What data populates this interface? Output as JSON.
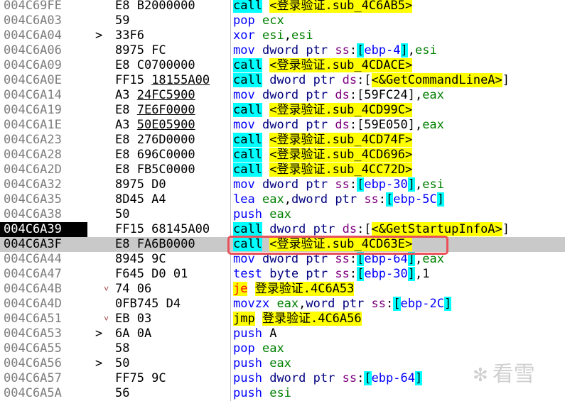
{
  "rows": [
    {
      "addr": "004C69FE",
      "mark": "",
      "bytes": [
        [
          "E8 B2000000",
          false
        ]
      ],
      "instr": [
        [
          "call",
          "m-call"
        ],
        [
          " ",
          ""
        ],
        [
          "<登录验证.sub_4C6AB5>",
          "t-yellow"
        ]
      ]
    },
    {
      "addr": "004C6A03",
      "mark": "",
      "bytes": [
        [
          "59",
          false
        ]
      ],
      "instr": [
        [
          "pop",
          "m-plain"
        ],
        [
          " ",
          ""
        ],
        [
          "ecx",
          "t-reg"
        ]
      ]
    },
    {
      "addr": "004C6A04",
      "mark": ">",
      "bytes": [
        [
          "33F6",
          false
        ]
      ],
      "instr": [
        [
          "xor",
          "m-plain"
        ],
        [
          " ",
          ""
        ],
        [
          "esi",
          "t-reg"
        ],
        [
          ",",
          "t-sep"
        ],
        [
          "esi",
          "t-reg"
        ]
      ]
    },
    {
      "addr": "004C6A06",
      "mark": "",
      "bytes": [
        [
          "8975 FC",
          false
        ]
      ],
      "instr": [
        [
          "mov",
          "m-plain"
        ],
        [
          " ",
          ""
        ],
        [
          "dword ptr",
          "t-size"
        ],
        [
          " ",
          ""
        ],
        [
          "ss",
          "t-seg"
        ],
        [
          ":",
          ""
        ],
        [
          "[",
          "t-br"
        ],
        [
          "ebp-4",
          "t-mem"
        ],
        [
          "]",
          "t-br"
        ],
        [
          ",",
          "t-sep"
        ],
        [
          "esi",
          "t-reg"
        ]
      ]
    },
    {
      "addr": "004C6A09",
      "mark": "",
      "bytes": [
        [
          "E8 C0700000",
          false
        ]
      ],
      "instr": [
        [
          "call",
          "m-call"
        ],
        [
          " ",
          ""
        ],
        [
          "<登录验证.sub_4CDACE>",
          "t-yellow"
        ]
      ]
    },
    {
      "addr": "004C6A0E",
      "mark": "",
      "bytes": [
        [
          "FF15 ",
          false
        ],
        [
          "18155A00",
          true
        ]
      ],
      "instr": [
        [
          "call",
          "m-call"
        ],
        [
          " ",
          ""
        ],
        [
          "dword ptr",
          "t-size"
        ],
        [
          " ",
          ""
        ],
        [
          "ds",
          "t-seg"
        ],
        [
          ":[",
          ""
        ],
        [
          "<&GetCommandLineA>",
          "t-yellow"
        ],
        [
          "]",
          ""
        ]
      ]
    },
    {
      "addr": "004C6A14",
      "mark": "",
      "bytes": [
        [
          "A3 ",
          false
        ],
        [
          "24FC5900",
          true
        ]
      ],
      "instr": [
        [
          "mov",
          "m-plain"
        ],
        [
          " ",
          ""
        ],
        [
          "dword ptr",
          "t-size"
        ],
        [
          " ",
          ""
        ],
        [
          "ds",
          "t-seg"
        ],
        [
          ":[59FC24],",
          ""
        ],
        [
          "eax",
          "t-reg"
        ]
      ]
    },
    {
      "addr": "004C6A19",
      "mark": "",
      "bytes": [
        [
          "E8 ",
          false
        ],
        [
          "7E6F0000",
          true
        ]
      ],
      "instr": [
        [
          "call",
          "m-call"
        ],
        [
          " ",
          ""
        ],
        [
          "<登录验证.sub_4CD99C>",
          "t-yellow"
        ]
      ]
    },
    {
      "addr": "004C6A1E",
      "mark": "",
      "bytes": [
        [
          "A3 ",
          false
        ],
        [
          "50E05900",
          true
        ]
      ],
      "instr": [
        [
          "mov",
          "m-plain"
        ],
        [
          " ",
          ""
        ],
        [
          "dword ptr",
          "t-size"
        ],
        [
          " ",
          ""
        ],
        [
          "ds",
          "t-seg"
        ],
        [
          ":[59E050],",
          ""
        ],
        [
          "eax",
          "t-reg"
        ]
      ]
    },
    {
      "addr": "004C6A23",
      "mark": "",
      "bytes": [
        [
          "E8 276D0000",
          false
        ]
      ],
      "instr": [
        [
          "call",
          "m-call"
        ],
        [
          " ",
          ""
        ],
        [
          "<登录验证.sub_4CD74F>",
          "t-yellow"
        ]
      ]
    },
    {
      "addr": "004C6A28",
      "mark": "",
      "bytes": [
        [
          "E8 696C0000",
          false
        ]
      ],
      "instr": [
        [
          "call",
          "m-call"
        ],
        [
          " ",
          ""
        ],
        [
          "<登录验证.sub_4CD696>",
          "t-yellow"
        ]
      ]
    },
    {
      "addr": "004C6A2D",
      "mark": "",
      "bytes": [
        [
          "E8 FB5C0000",
          false
        ]
      ],
      "instr": [
        [
          "call",
          "m-call"
        ],
        [
          " ",
          ""
        ],
        [
          "<登录验证.sub_4CC72D>",
          "t-yellow"
        ]
      ]
    },
    {
      "addr": "004C6A32",
      "mark": "",
      "bytes": [
        [
          "8975 D0",
          false
        ]
      ],
      "instr": [
        [
          "mov",
          "m-plain"
        ],
        [
          " ",
          ""
        ],
        [
          "dword ptr",
          "t-size"
        ],
        [
          " ",
          ""
        ],
        [
          "ss",
          "t-seg"
        ],
        [
          ":",
          ""
        ],
        [
          "[",
          "t-br"
        ],
        [
          "ebp-30",
          "t-mem"
        ],
        [
          "]",
          "t-br"
        ],
        [
          ",",
          "t-sep"
        ],
        [
          "esi",
          "t-reg"
        ]
      ]
    },
    {
      "addr": "004C6A35",
      "mark": "",
      "bytes": [
        [
          "8D45 A4",
          false
        ]
      ],
      "instr": [
        [
          "lea",
          "m-plain"
        ],
        [
          " ",
          ""
        ],
        [
          "eax",
          "t-reg"
        ],
        [
          ",",
          "t-sep"
        ],
        [
          "dword ptr",
          "t-size"
        ],
        [
          " ",
          ""
        ],
        [
          "ss",
          "t-seg"
        ],
        [
          ":",
          ""
        ],
        [
          "[",
          "t-br"
        ],
        [
          "ebp-5C",
          "t-mem"
        ],
        [
          "]",
          "t-br"
        ]
      ]
    },
    {
      "addr": "004C6A38",
      "mark": "",
      "bytes": [
        [
          "50",
          false
        ]
      ],
      "instr": [
        [
          "push",
          "m-plain"
        ],
        [
          " ",
          ""
        ],
        [
          "eax",
          "t-reg"
        ]
      ]
    },
    {
      "addr": "004C6A39",
      "mark": "",
      "cur": true,
      "bytes": [
        [
          "FF15 68145A00",
          false
        ]
      ],
      "instr": [
        [
          "call",
          "m-call"
        ],
        [
          " ",
          ""
        ],
        [
          "dword ptr",
          "t-size"
        ],
        [
          " ",
          ""
        ],
        [
          "ds",
          "t-seg"
        ],
        [
          ":[",
          ""
        ],
        [
          "<&GetStartupInfoA>",
          "t-yellow"
        ],
        [
          "]",
          ""
        ]
      ]
    },
    {
      "addr": "004C6A3F",
      "mark": "",
      "sel": true,
      "bytes": [
        [
          "E8 FA6B0000",
          false
        ]
      ],
      "instr": [
        [
          "call",
          "m-call"
        ],
        [
          " ",
          ""
        ],
        [
          "<登录验证.sub_4CD63E>",
          "t-yellow"
        ]
      ]
    },
    {
      "addr": "004C6A44",
      "mark": "",
      "bytes": [
        [
          "8945 9C",
          false
        ]
      ],
      "instr": [
        [
          "mov",
          "m-plain"
        ],
        [
          " ",
          ""
        ],
        [
          "dword ptr",
          "t-size"
        ],
        [
          " ",
          ""
        ],
        [
          "ss",
          "t-seg"
        ],
        [
          ":",
          ""
        ],
        [
          "[",
          "t-br"
        ],
        [
          "ebp-64",
          "t-mem"
        ],
        [
          "]",
          "t-br"
        ],
        [
          ",",
          "t-sep"
        ],
        [
          "eax",
          "t-reg"
        ]
      ]
    },
    {
      "addr": "004C6A47",
      "mark": "",
      "bytes": [
        [
          "F645 D0 01",
          false
        ]
      ],
      "instr": [
        [
          "test",
          "m-plain"
        ],
        [
          " ",
          ""
        ],
        [
          "byte ptr",
          "t-size"
        ],
        [
          " ",
          ""
        ],
        [
          "ss",
          "t-seg"
        ],
        [
          ":",
          ""
        ],
        [
          "[",
          "t-br"
        ],
        [
          "ebp-30",
          "t-mem"
        ],
        [
          "]",
          "t-br"
        ],
        [
          ",1",
          "t-num"
        ]
      ]
    },
    {
      "addr": "004C6A4B",
      "mark": "v",
      "bytes": [
        [
          "74 06",
          false
        ]
      ],
      "instr": [
        [
          "je",
          "m-jcc"
        ],
        [
          " ",
          ""
        ],
        [
          "登录验证.4C6A53",
          "t-yellow"
        ]
      ]
    },
    {
      "addr": "004C6A4D",
      "mark": "",
      "bytes": [
        [
          "0FB745 D4",
          false
        ]
      ],
      "instr": [
        [
          "movzx",
          "m-plain"
        ],
        [
          " ",
          ""
        ],
        [
          "eax",
          "t-reg"
        ],
        [
          ",",
          "t-sep"
        ],
        [
          "word ptr",
          "t-size"
        ],
        [
          " ",
          ""
        ],
        [
          "ss",
          "t-seg"
        ],
        [
          ":",
          ""
        ],
        [
          "[",
          "t-br"
        ],
        [
          "ebp-2C",
          "t-mem"
        ],
        [
          "]",
          "t-br"
        ]
      ]
    },
    {
      "addr": "004C6A51",
      "mark": "v",
      "bytes": [
        [
          "EB 03",
          false
        ]
      ],
      "instr": [
        [
          "jmp",
          "m-jmp"
        ],
        [
          " ",
          ""
        ],
        [
          "登录验证.4C6A56",
          "t-yellow"
        ]
      ]
    },
    {
      "addr": "004C6A53",
      "mark": ">",
      "bytes": [
        [
          "6A 0A",
          false
        ]
      ],
      "instr": [
        [
          "push",
          "m-plain"
        ],
        [
          " ",
          ""
        ],
        [
          "A",
          "t-num"
        ]
      ]
    },
    {
      "addr": "004C6A55",
      "mark": "",
      "bytes": [
        [
          "58",
          false
        ]
      ],
      "instr": [
        [
          "pop",
          "m-plain"
        ],
        [
          " ",
          ""
        ],
        [
          "eax",
          "t-reg"
        ]
      ]
    },
    {
      "addr": "004C6A56",
      "mark": ">",
      "bytes": [
        [
          "50",
          false
        ]
      ],
      "instr": [
        [
          "push",
          "m-plain"
        ],
        [
          " ",
          ""
        ],
        [
          "eax",
          "t-reg"
        ]
      ]
    },
    {
      "addr": "004C6A57",
      "mark": "",
      "bytes": [
        [
          "FF75 9C",
          false
        ]
      ],
      "instr": [
        [
          "push",
          "m-plain"
        ],
        [
          " ",
          ""
        ],
        [
          "dword ptr",
          "t-size"
        ],
        [
          " ",
          ""
        ],
        [
          "ss",
          "t-seg"
        ],
        [
          ":",
          ""
        ],
        [
          "[",
          "t-br"
        ],
        [
          "ebp-64",
          "t-mem"
        ],
        [
          "]",
          "t-br"
        ]
      ]
    },
    {
      "addr": "004C6A5A",
      "mark": "",
      "bytes": [
        [
          "56",
          false
        ]
      ],
      "instr": [
        [
          "push",
          "m-plain"
        ],
        [
          " ",
          ""
        ],
        [
          "esi",
          "t-reg"
        ]
      ]
    }
  ],
  "watermark": {
    "icon": "snowflake-logo-icon",
    "text": "看雪"
  }
}
